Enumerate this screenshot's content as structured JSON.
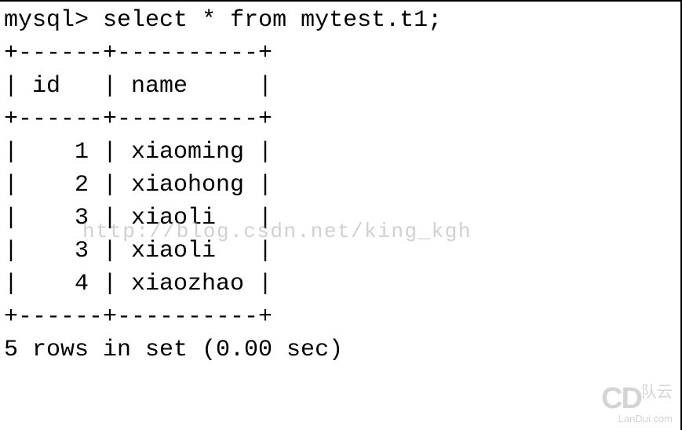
{
  "terminal": {
    "prompt": "mysql>",
    "command": "select * from mytest.t1;",
    "table": {
      "border_top": "+------+----------+",
      "header_row": "| id   | name     |",
      "border_mid": "+------+----------+",
      "rows": [
        "|    1 | xiaoming |",
        "|    2 | xiaohong |",
        "|    3 | xiaoli   |",
        "|    3 | xiaoli   |",
        "|    4 | xiaozhao |"
      ],
      "border_bot": "+------+----------+"
    },
    "status": "5 rows in set (0.00 sec)"
  },
  "chart_data": {
    "type": "table",
    "columns": [
      "id",
      "name"
    ],
    "rows": [
      [
        1,
        "xiaoming"
      ],
      [
        2,
        "xiaohong"
      ],
      [
        3,
        "xiaoli"
      ],
      [
        3,
        "xiaoli"
      ],
      [
        4,
        "xiaozhao"
      ]
    ],
    "row_count": 5,
    "query_time_sec": 0.0,
    "query": "select * from mytest.t1;"
  },
  "watermarks": {
    "center": "http://blog.csdn.net/king_kgh",
    "corner_brand_symbol": "CD",
    "corner_brand_cn": "队云",
    "corner_brand_domain": "LanDui.com"
  }
}
